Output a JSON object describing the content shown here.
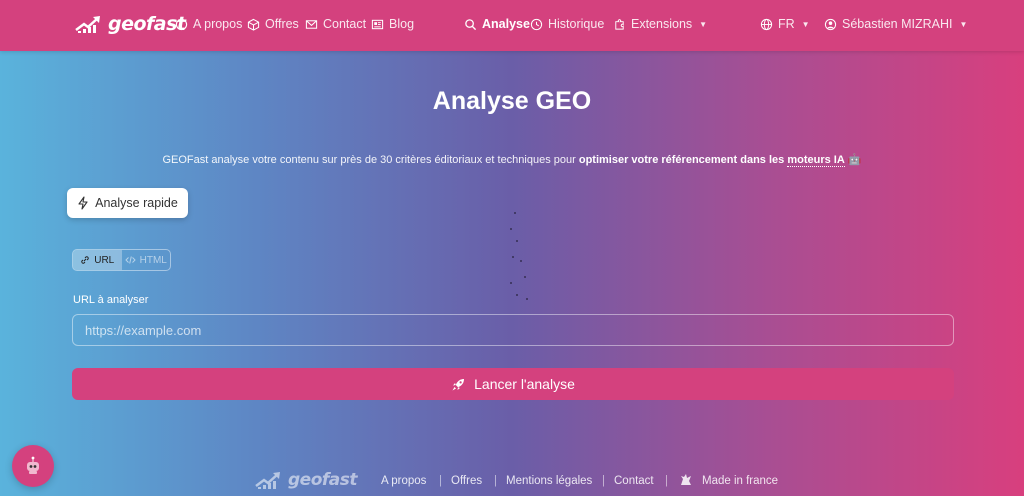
{
  "navbar": {
    "brand": "geofast",
    "links": [
      {
        "label": "A propos",
        "icon": "info-icon"
      },
      {
        "label": "Offres",
        "icon": "box-icon"
      },
      {
        "label": "Contact",
        "icon": "mail-icon"
      },
      {
        "label": "Blog",
        "icon": "newspaper-icon"
      }
    ],
    "center": [
      {
        "label": "Analyse",
        "icon": "search-icon",
        "active": true
      },
      {
        "label": "Historique",
        "icon": "clock-icon"
      },
      {
        "label": "Extensions",
        "icon": "puzzle-icon",
        "dropdown": true
      }
    ],
    "language": "FR",
    "user": "Sébastien MIZRAHI"
  },
  "main": {
    "title": "Analyse GEO",
    "subtitle_prefix": "GEOFast analyse votre contenu sur près de 30 critères éditoriaux et techniques pour ",
    "subtitle_bold1": "optimiser votre référencement dans les ",
    "subtitle_bold2": "moteurs IA",
    "quick_button": "Analyse rapide",
    "toggle": {
      "url": "URL",
      "html": "HTML",
      "selected": "URL"
    },
    "url_label": "URL à analyser",
    "url_placeholder": "https://example.com",
    "url_value": "",
    "launch_button": "Lancer l'analyse"
  },
  "footer": {
    "brand": "geofast",
    "links": [
      "A propos",
      "Offres",
      "Mentions légales",
      "Contact"
    ],
    "made_in": "Made in france"
  },
  "colors": {
    "accent": "#d4417e",
    "gradient_start": "#5ab3dc",
    "gradient_end": "#d83f7e"
  }
}
